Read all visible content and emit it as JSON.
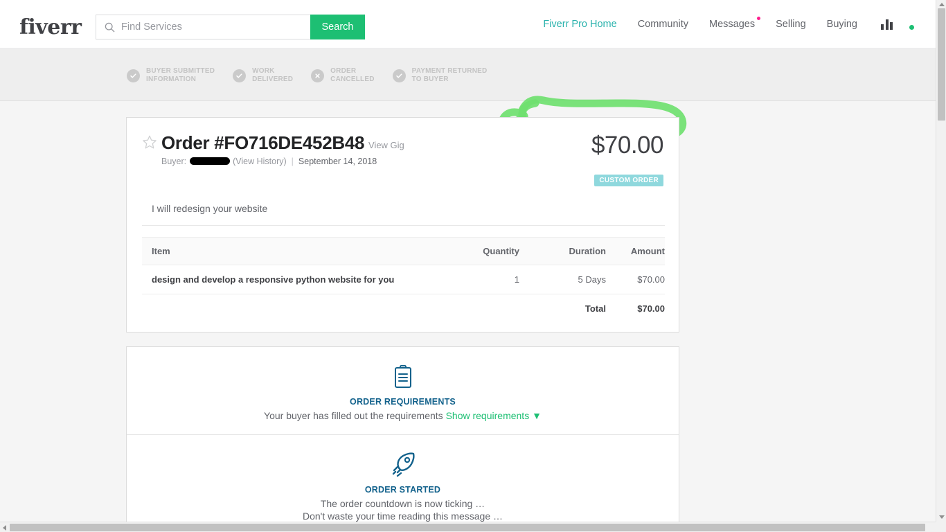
{
  "header": {
    "logo_text": "fiverr",
    "search": {
      "placeholder": "Find Services",
      "value": "",
      "button_label": "Search",
      "icon": "search-icon"
    },
    "nav": [
      {
        "label": "Fiverr Pro Home",
        "accent": true,
        "color": "#29b2ac"
      },
      {
        "label": "Community",
        "accent": false
      },
      {
        "label": "Messages",
        "accent": false,
        "dot": true
      },
      {
        "label": "Selling",
        "accent": false
      },
      {
        "label": "Buying",
        "accent": false
      }
    ],
    "analytics_icon": "bar-chart-icon",
    "avatar_icon": "user-avatar",
    "online_status": "online"
  },
  "status_band": {
    "steps": [
      {
        "label": "BUYER SUBMITTED\nINFORMATION",
        "icon": "check-circle-icon"
      },
      {
        "label": "WORK\nDELIVERED",
        "icon": "check-circle-icon"
      },
      {
        "label": "ORDER\nCANCELLED",
        "icon": "x-circle-icon"
      },
      {
        "label": "PAYMENT RETURNED\nTO BUYER",
        "icon": "check-circle-icon"
      }
    ],
    "status_prefix": "ORDER ",
    "status_emphasis": "CANCELLED",
    "annotation": {
      "shape": "hand-drawn-circle-highlight",
      "color": "#6fe06f"
    }
  },
  "order_card": {
    "favorite_icon": "star-outline-icon",
    "title": "Order #FO716DE452B48",
    "view_gig_label": "View Gig",
    "buyer_label": "Buyer:",
    "buyer_name": "redacted",
    "view_history_label": "(View History)",
    "date": "September 14, 2018",
    "price": "$70.00",
    "badge": "CUSTOM ORDER",
    "badge_color": "#8fd8dd",
    "gig_description": "I will redesign your website",
    "table": {
      "headers": [
        "Item",
        "Quantity",
        "Duration",
        "Amount"
      ],
      "rows": [
        {
          "item": "design and develop a responsive python website for you",
          "quantity": "1",
          "duration": "5 Days",
          "amount": "$70.00"
        }
      ],
      "total_label": "Total",
      "total_value": "$70.00"
    }
  },
  "events": [
    {
      "icon": "clipboard-icon",
      "title": "ORDER REQUIREMENTS",
      "body_text": "Your buyer has filled out the requirements",
      "link_text": "Show requirements ▼",
      "link_color": "#1dbf73",
      "line2": ""
    },
    {
      "icon": "rocket-icon",
      "title": "ORDER STARTED",
      "body_text": "The order countdown is now ticking …",
      "line2": "Don't waste your time reading this message …",
      "link_text": ""
    }
  ]
}
